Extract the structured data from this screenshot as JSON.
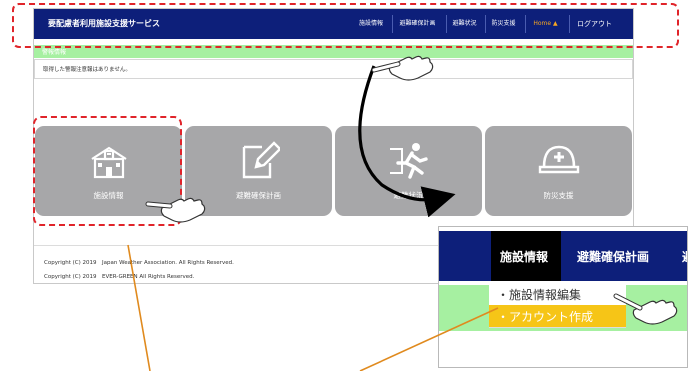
{
  "app": {
    "title": "要配慮者利用施設支援サービス"
  },
  "nav": {
    "items": [
      {
        "label": "施設情報"
      },
      {
        "label": "避難確保計画"
      },
      {
        "label": "避難状況"
      },
      {
        "label": "防災支援"
      },
      {
        "label": "Home"
      },
      {
        "label": "ログアウト"
      }
    ],
    "home_color": "#f6a623"
  },
  "warnings": {
    "title": "警報情報",
    "message": "取得した警報注意報はありません。"
  },
  "tiles": [
    {
      "label": "施設情報",
      "icon": "school-building-icon"
    },
    {
      "label": "避難確保計画",
      "icon": "pencil-document-icon"
    },
    {
      "label": "避難状況",
      "icon": "running-person-icon"
    },
    {
      "label": "防災支援",
      "icon": "safety-helmet-icon"
    }
  ],
  "footer": {
    "copyright1": "Copyright (C) 2019　Japan Weather Association. All Rights Reserved.",
    "copyright2": "Copyright (C) 2019　EVER-GREEN All Rights Reserved."
  },
  "inset": {
    "nav_active": "施設情報",
    "nav_next": "避難確保計画",
    "nav_cut": "避",
    "dropdown": [
      "・施設情報編集",
      "・アカウント作成"
    ]
  },
  "colors": {
    "navbar": "#0d1f7a",
    "warning_bar": "#a6f0a1",
    "tile": "#a7a7a9",
    "annotation": "#e0242a",
    "callout_line": "#e08a1e",
    "dropdown_highlight": "#f6c517"
  }
}
